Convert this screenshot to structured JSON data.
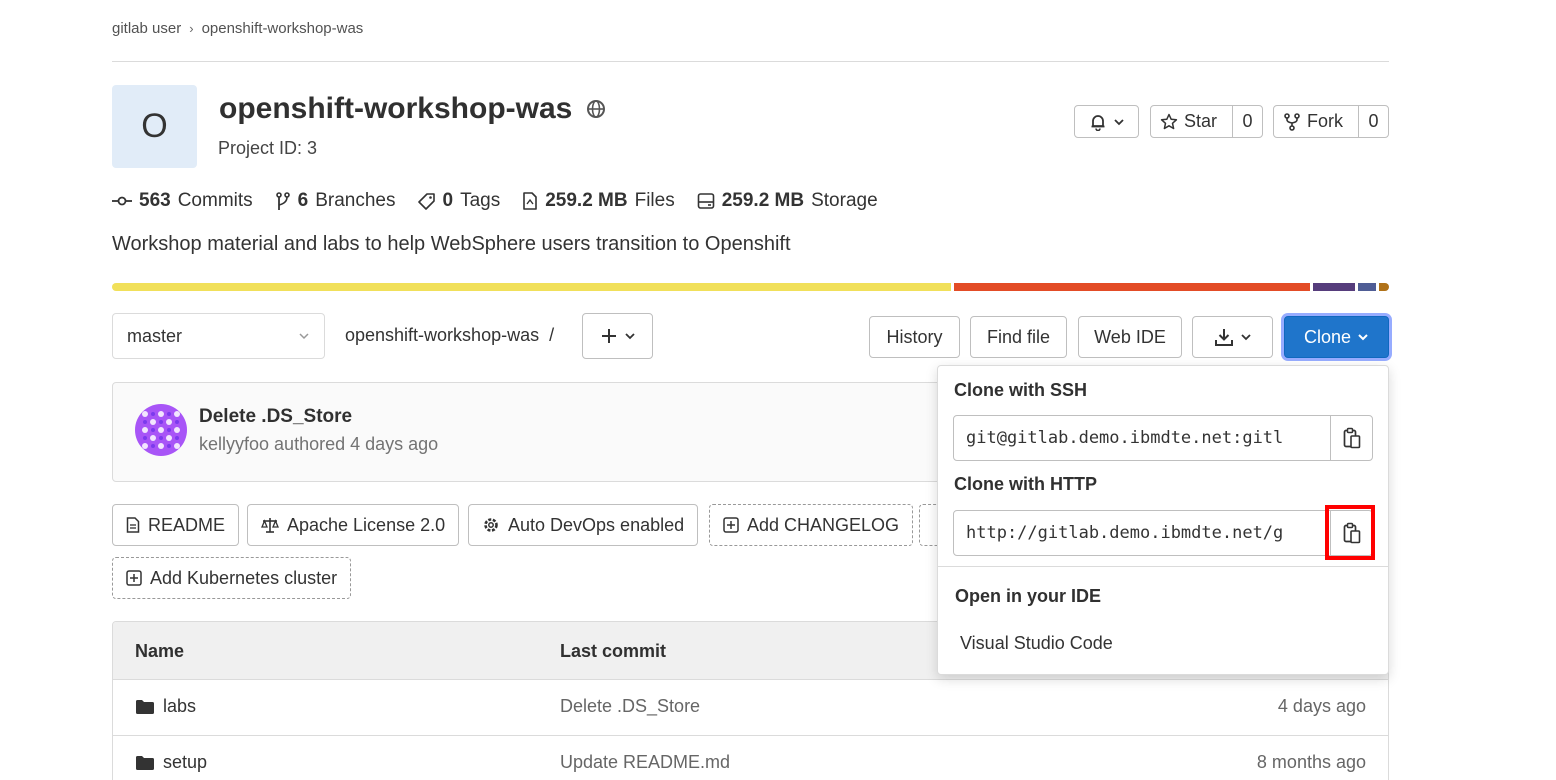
{
  "breadcrumb": {
    "parent": "gitlab user",
    "separator": "›",
    "current": "openshift-workshop-was"
  },
  "project": {
    "avatar_letter": "O",
    "name": "openshift-workshop-was",
    "visibility_icon": "globe-icon",
    "id_label": "Project ID: 3",
    "description": "Workshop material and labs to help WebSphere users transition to Openshift"
  },
  "actions": {
    "star_label": "Star",
    "star_count": "0",
    "fork_label": "Fork",
    "fork_count": "0"
  },
  "stats": {
    "commits_count": "563",
    "commits_label": "Commits",
    "branches_count": "6",
    "branches_label": "Branches",
    "tags_count": "0",
    "tags_label": "Tags",
    "files_size": "259.2 MB",
    "files_label": "Files",
    "storage_size": "259.2 MB",
    "storage_label": "Storage"
  },
  "languages": [
    {
      "color": "#f1e05a",
      "share": 66
    },
    {
      "color": "#e34c26",
      "share": 28
    },
    {
      "color": "#563d7c",
      "share": 3.3
    },
    {
      "color": "#4f5d95",
      "share": 1.4
    },
    {
      "color": "#b07219",
      "share": 0.8
    }
  ],
  "repo_nav": {
    "branch": "master",
    "path": "openshift-workshop-was",
    "path_sep": "/",
    "history_label": "History",
    "find_file_label": "Find file",
    "web_ide_label": "Web IDE",
    "clone_label": "Clone"
  },
  "last_commit": {
    "title": "Delete .DS_Store",
    "author": "kellyyfoo",
    "meta": "authored 4 days ago"
  },
  "quick_links": {
    "readme": "README",
    "license": "Apache License 2.0",
    "autodevops": "Auto DevOps enabled",
    "changelog": "Add CHANGELOG",
    "kubernetes": "Add Kubernetes cluster"
  },
  "clone_dropdown": {
    "ssh_label": "Clone with SSH",
    "ssh_url": "git@gitlab.demo.ibmdte.net:gitl",
    "http_label": "Clone with HTTP",
    "http_url": "http://gitlab.demo.ibmdte.net/g",
    "ide_label": "Open in your IDE",
    "ide_option": "Visual Studio Code"
  },
  "file_table": {
    "headers": {
      "name": "Name",
      "last_commit": "Last commit"
    },
    "rows": [
      {
        "name": "labs",
        "commit": "Delete .DS_Store",
        "updated": "4 days ago"
      },
      {
        "name": "setup",
        "commit": "Update README.md",
        "updated": "8 months ago"
      }
    ]
  },
  "colors": {
    "clone_button": "#1f75cb",
    "highlight": "#ff0000"
  }
}
